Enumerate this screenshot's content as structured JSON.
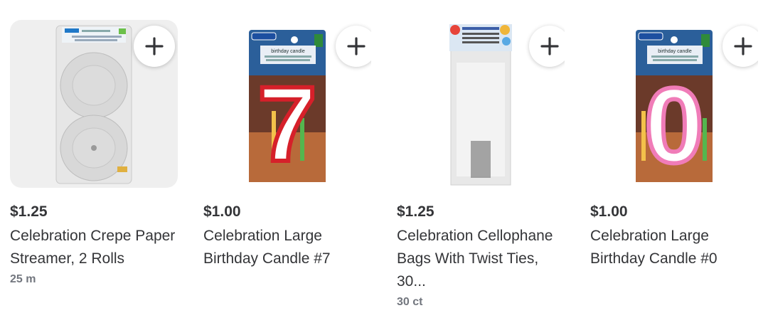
{
  "products": [
    {
      "price": "$1.25",
      "title": "Celebration Crepe Paper Streamer, 2 Rolls",
      "size": "25 m",
      "image_icon": "crepe-streamer-image",
      "add_icon": "plus-icon"
    },
    {
      "price": "$1.00",
      "title": "Celebration Large Birthday Candle #7",
      "size": "",
      "image_icon": "candle-7-image",
      "add_icon": "plus-icon",
      "package_text": "birthday candle",
      "digit": "7"
    },
    {
      "price": "$1.25",
      "title": "Celebration Cellophane Bags With Twist Ties, 30...",
      "size": "30 ct",
      "image_icon": "cellophane-bags-image",
      "add_icon": "plus-icon"
    },
    {
      "price": "$1.00",
      "title": "Celebration Large Birthday Candle #0",
      "size": "",
      "image_icon": "candle-0-image",
      "add_icon": "plus-icon",
      "package_text": "birthday candle",
      "digit": "0"
    }
  ],
  "colors": {
    "text": "#343538",
    "muted": "#72767e",
    "card_bg": "#efefef",
    "candle7_outline": "#d6202a",
    "candle0_outline": "#f07cb8"
  }
}
